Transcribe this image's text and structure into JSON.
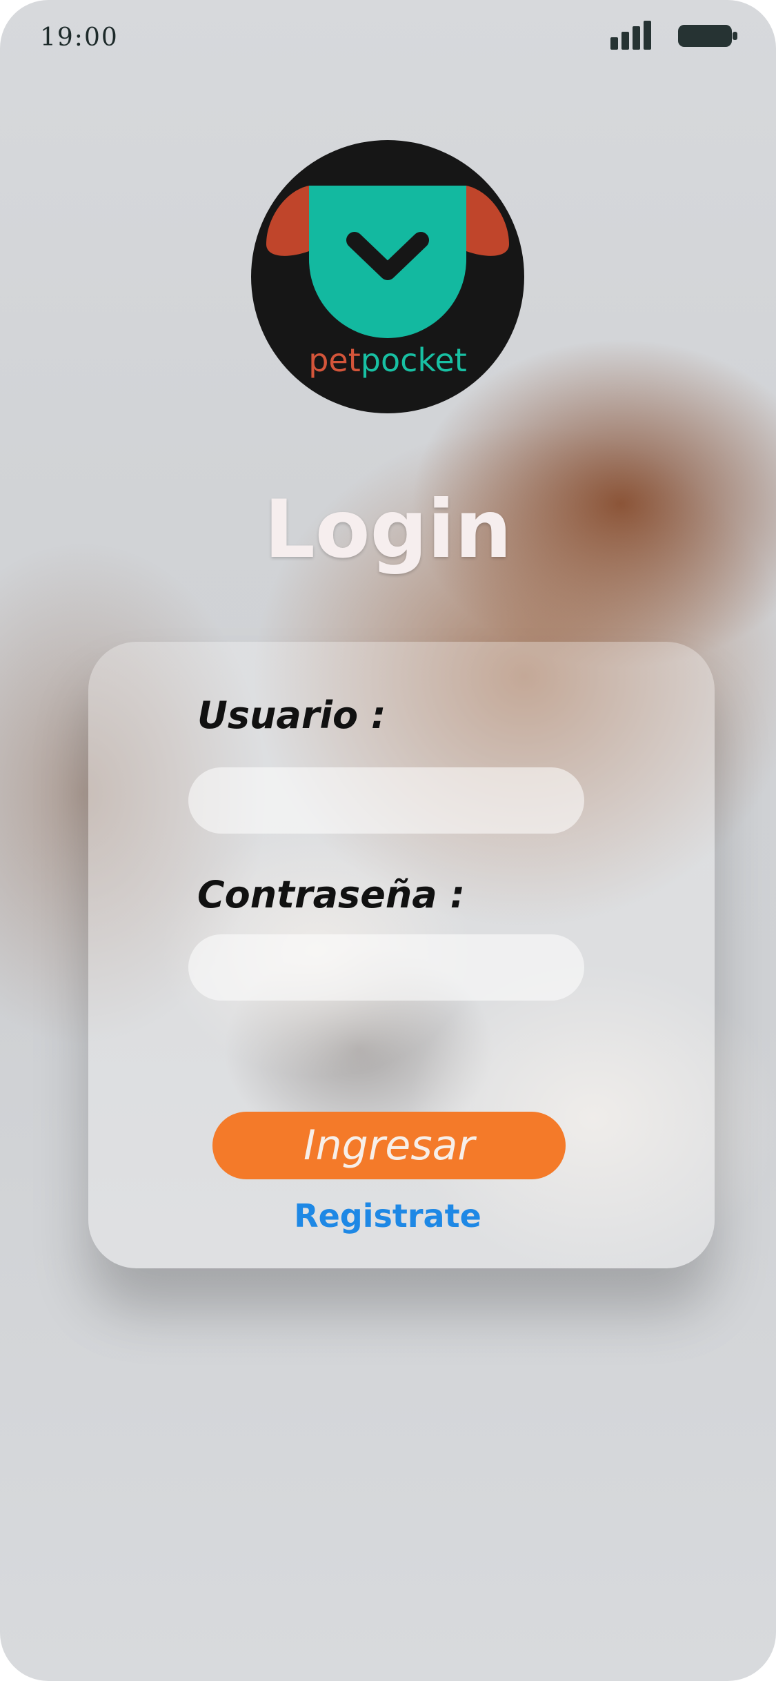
{
  "status_bar": {
    "time": "19:00",
    "signal_icon": "signal-bars-icon",
    "battery_icon": "battery-icon"
  },
  "logo": {
    "brand_part1": "pet",
    "brand_part2": "pocket",
    "colors": {
      "circle": "#161616",
      "head": "#13b9a0",
      "ears": "#c0452b",
      "brand_part1": "#d4553a",
      "brand_part2": "#18c0a3"
    }
  },
  "title": "Login",
  "form": {
    "username_label": "Usuario :",
    "username_value": "",
    "password_label": "Contraseña :",
    "password_value": "",
    "submit_label": "Ingresar",
    "register_label": "Registrate"
  },
  "colors": {
    "button": "#f47a29",
    "link": "#1e88e5",
    "title": "#f6eeee"
  }
}
